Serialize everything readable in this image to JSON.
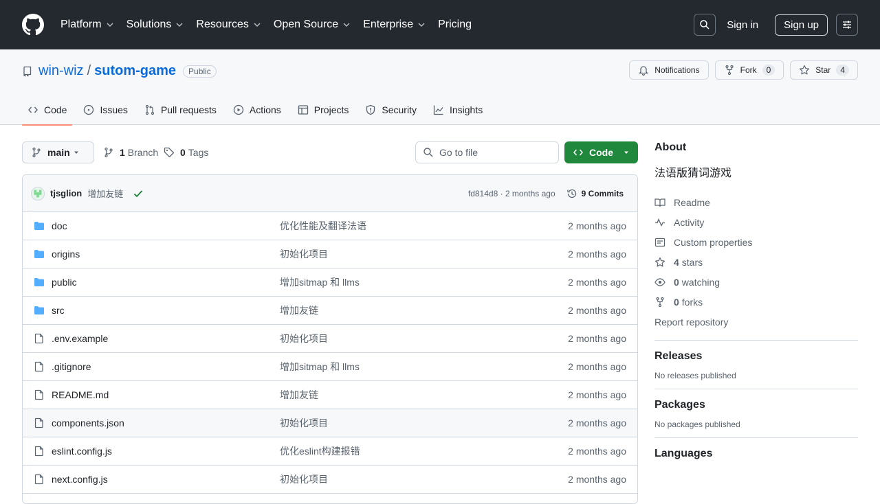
{
  "header": {
    "nav": [
      {
        "label": "Platform",
        "has_menu": true
      },
      {
        "label": "Solutions",
        "has_menu": true
      },
      {
        "label": "Resources",
        "has_menu": true
      },
      {
        "label": "Open Source",
        "has_menu": true
      },
      {
        "label": "Enterprise",
        "has_menu": true
      },
      {
        "label": "Pricing",
        "has_menu": false
      }
    ],
    "signin": "Sign in",
    "signup": "Sign up"
  },
  "repo": {
    "owner": "win-wiz",
    "separator": "/",
    "name": "sutom-game",
    "visibility": "Public",
    "actions": {
      "notifications": "Notifications",
      "fork": "Fork",
      "fork_count": "0",
      "star": "Star",
      "star_count": "4"
    },
    "tabs": [
      "Code",
      "Issues",
      "Pull requests",
      "Actions",
      "Projects",
      "Security",
      "Insights"
    ]
  },
  "toolbar": {
    "branch": "main",
    "branches_count": "1",
    "branches_label": "Branch",
    "tags_count": "0",
    "tags_label": "Tags",
    "gofile_placeholder": "Go to file",
    "code_button": "Code"
  },
  "commit": {
    "author": "tjsglion",
    "message": "增加友链",
    "hash_time": "fd814d8 · 2 months ago",
    "commits_count": "9 Commits"
  },
  "files": [
    {
      "type": "dir",
      "name": "doc",
      "message": "优化性能及翻译法语",
      "date": "2 months ago"
    },
    {
      "type": "dir",
      "name": "origins",
      "message": "初始化项目",
      "date": "2 months ago"
    },
    {
      "type": "dir",
      "name": "public",
      "message": "增加sitmap 和 llms",
      "date": "2 months ago"
    },
    {
      "type": "dir",
      "name": "src",
      "message": "增加友链",
      "date": "2 months ago"
    },
    {
      "type": "file",
      "name": ".env.example",
      "message": "初始化项目",
      "date": "2 months ago"
    },
    {
      "type": "file",
      "name": ".gitignore",
      "message": "增加sitmap 和 llms",
      "date": "2 months ago"
    },
    {
      "type": "file",
      "name": "README.md",
      "message": "增加友链",
      "date": "2 months ago"
    },
    {
      "type": "file",
      "name": "components.json",
      "message": "初始化项目",
      "date": "2 months ago"
    },
    {
      "type": "file",
      "name": "eslint.config.js",
      "message": "优化eslint构建报错",
      "date": "2 months ago"
    },
    {
      "type": "file",
      "name": "next.config.js",
      "message": "初始化项目",
      "date": "2 months ago"
    }
  ],
  "about": {
    "title": "About",
    "description": "法语版猜词游戏",
    "readme": "Readme",
    "activity": "Activity",
    "custom_properties": "Custom properties",
    "stars_count": "4",
    "stars_label": "stars",
    "watching_count": "0",
    "watching_label": "watching",
    "forks_count": "0",
    "forks_label": "forks",
    "report": "Report repository"
  },
  "releases": {
    "title": "Releases",
    "text": "No releases published"
  },
  "packages": {
    "title": "Packages",
    "text": "No packages published"
  },
  "languages": {
    "title": "Languages"
  },
  "colors": {
    "header_bg": "#24292f",
    "link": "#0969da",
    "code_button": "#1f883d",
    "folder": "#54aeff",
    "active_tab": "#fd8c73",
    "check": "#1a7f37"
  }
}
